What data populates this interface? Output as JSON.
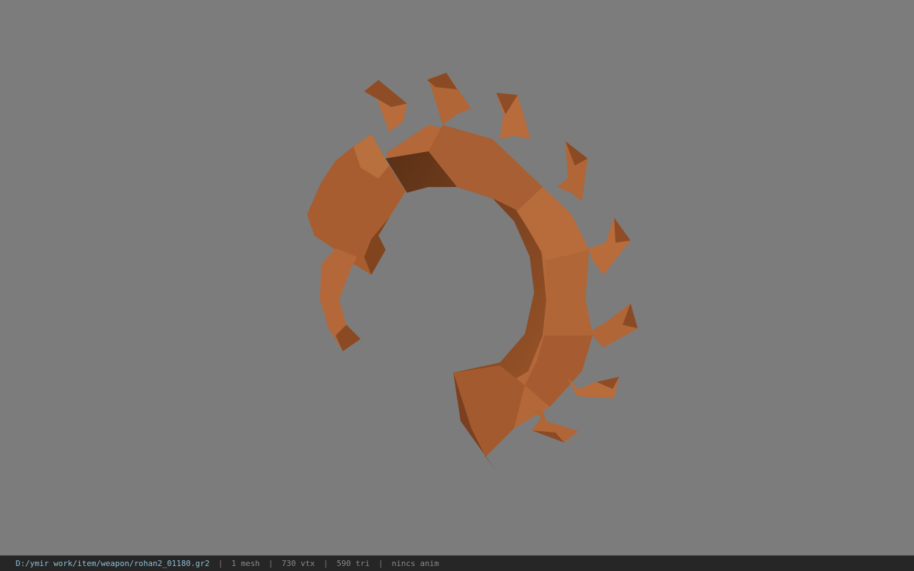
{
  "viewer": {
    "background_color": "#7c7c7c",
    "model_color": "#b4683a",
    "model": {
      "description_icon": "crescent-weapon-mesh-icon"
    }
  },
  "status_bar": {
    "file_path": "D:/ymir work/item/weapon/rohan2_01180.gr2",
    "separator": "|",
    "mesh_count": "1 mesh",
    "vertex_count": "730 vtx",
    "triangle_count": "590 tri",
    "anim_status": "nincs anim"
  }
}
